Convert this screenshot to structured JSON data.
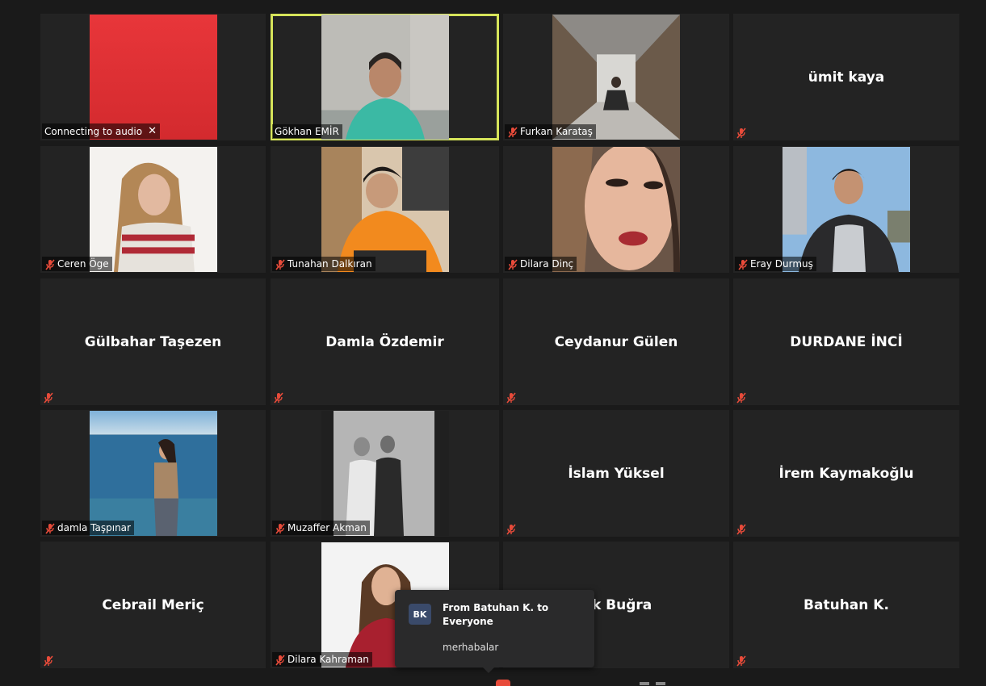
{
  "tiles": [
    {
      "row": 0,
      "col": 0,
      "type": "video",
      "label": "Connecting to audio",
      "show_close": true,
      "muted": false,
      "scene": "red"
    },
    {
      "row": 0,
      "col": 1,
      "type": "video",
      "label": "Gökhan EMİR",
      "muted": false,
      "active": true,
      "scene": "man-office"
    },
    {
      "row": 0,
      "col": 2,
      "type": "video",
      "label": "Furkan Karataş",
      "muted": true,
      "scene": "warehouse"
    },
    {
      "row": 0,
      "col": 3,
      "type": "name",
      "name": "ümit kaya",
      "muted": true
    },
    {
      "row": 1,
      "col": 0,
      "type": "video",
      "label": "Ceren Öge",
      "muted": true,
      "scene": "woman-white"
    },
    {
      "row": 1,
      "col": 1,
      "type": "video",
      "label": "Tunahan Dalkıran",
      "muted": true,
      "scene": "man-orange"
    },
    {
      "row": 1,
      "col": 2,
      "type": "video",
      "label": "Dilara Dinç",
      "muted": true,
      "scene": "woman-closeup"
    },
    {
      "row": 1,
      "col": 3,
      "type": "video",
      "label": "Eray Durmuş",
      "muted": true,
      "scene": "man-outdoor"
    },
    {
      "row": 2,
      "col": 0,
      "type": "name",
      "name": "Gülbahar Taşezen",
      "muted": true
    },
    {
      "row": 2,
      "col": 1,
      "type": "name",
      "name": "Damla Özdemir",
      "muted": true
    },
    {
      "row": 2,
      "col": 2,
      "type": "name",
      "name": "Ceydanur Gülen",
      "muted": true
    },
    {
      "row": 2,
      "col": 3,
      "type": "name",
      "name": "DURDANE İNCİ",
      "muted": true
    },
    {
      "row": 3,
      "col": 0,
      "type": "video",
      "label": "damla Taşpınar",
      "muted": true,
      "scene": "sea"
    },
    {
      "row": 3,
      "col": 1,
      "type": "video",
      "label": "Muzaffer Akman",
      "muted": true,
      "scene": "bw-mirror"
    },
    {
      "row": 3,
      "col": 2,
      "type": "name",
      "name": "İslam Yüksel",
      "muted": true
    },
    {
      "row": 3,
      "col": 3,
      "type": "name",
      "name": "İrem Kaymakoğlu",
      "muted": true
    },
    {
      "row": 4,
      "col": 0,
      "type": "name",
      "name": "Cebrail  Meriç",
      "muted": true
    },
    {
      "row": 4,
      "col": 1,
      "type": "video",
      "label": "Dilara Kahraman",
      "muted": true,
      "scene": "woman-red"
    },
    {
      "row": 4,
      "col": 2,
      "type": "name",
      "name": "rık Buğra",
      "muted": true
    },
    {
      "row": 4,
      "col": 3,
      "type": "name",
      "name": "Batuhan K.",
      "muted": true
    }
  ],
  "chat_popup": {
    "avatar_initials": "BK",
    "from_line": "From Batuhan K. to Everyone",
    "message": "merhabalar"
  },
  "colors": {
    "active_speaker_border": "#d6e45a",
    "muted_icon": "#e84b3a",
    "tile_bg": "#232323",
    "page_bg": "#1a1a1a"
  }
}
